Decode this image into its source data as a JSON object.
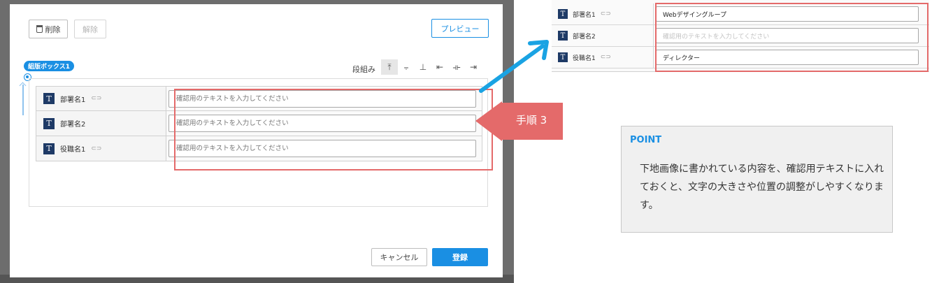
{
  "toolbar": {
    "delete_label": "削除",
    "clear_label": "解除",
    "preview_label": "プレビュー"
  },
  "group": {
    "badge": "組版ボックス1",
    "layout_label": "段組み",
    "tools": [
      "⤒",
      "⨪",
      "⊥",
      "⇤",
      "⟛",
      "⇥"
    ]
  },
  "fields": [
    {
      "label": "部署名1",
      "linked": true,
      "placeholder": "確認用のテキストを入力してください"
    },
    {
      "label": "部署名2",
      "linked": false,
      "placeholder": "確認用のテキストを入力してください"
    },
    {
      "label": "役職名1",
      "linked": true,
      "placeholder": "確認用のテキストを入力してください"
    }
  ],
  "footer": {
    "cancel_label": "キャンセル",
    "register_label": "登録"
  },
  "step": {
    "label": "手順 3"
  },
  "preview": {
    "rows": [
      {
        "label": "部署名1",
        "linked": true,
        "value": "Webデザイングループ",
        "placeholder": ""
      },
      {
        "label": "部署名2",
        "linked": false,
        "value": "",
        "placeholder": "確認用のテキストを入力してください"
      },
      {
        "label": "役職名1",
        "linked": true,
        "value": "ディレクター",
        "placeholder": ""
      }
    ]
  },
  "point": {
    "title": "POINT",
    "body": "下地画像に書かれている内容を、確認用テキストに入れておくと、文字の大きさや位置の調整がしやすくなります。"
  },
  "colors": {
    "accent": "#1a8fe3",
    "highlight": "#e46a6a",
    "icon_bg": "#1e3a66"
  }
}
